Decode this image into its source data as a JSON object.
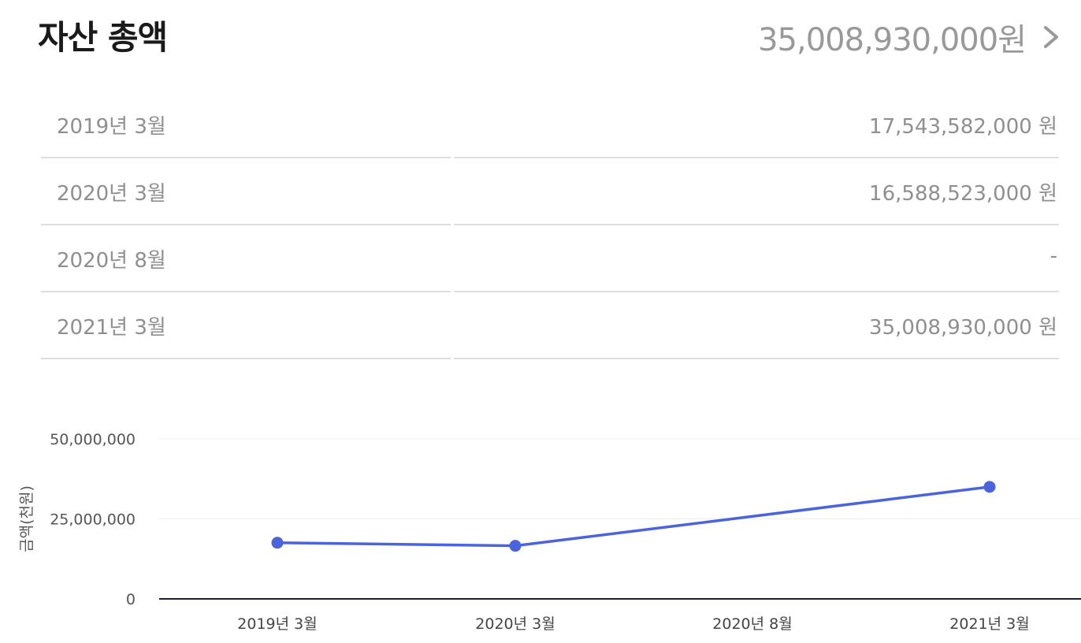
{
  "header": {
    "title": "자산 총액",
    "total": "35,008,930,000원"
  },
  "icons": {
    "total_link": "chevron-right-icon"
  },
  "table": {
    "rows": [
      {
        "label": "2019년 3월",
        "value": "17,543,582,000 원"
      },
      {
        "label": "2020년 3월",
        "value": "16,588,523,000 원"
      },
      {
        "label": "2020년 8월",
        "value": "-"
      },
      {
        "label": "2021년 3월",
        "value": "35,008,930,000 원"
      }
    ]
  },
  "chart_data": {
    "type": "line",
    "categories": [
      "2019년 3월",
      "2020년 3월",
      "2020년 8월",
      "2021년 3월"
    ],
    "series": [
      {
        "values": [
          17543582,
          16588523,
          null,
          35008930
        ]
      }
    ],
    "ylabel": "금액(천원)",
    "ylim": [
      0,
      50000000
    ],
    "yticks": [
      0,
      25000000,
      50000000
    ],
    "ytick_labels": [
      "0",
      "25,000,000",
      "50,000,000"
    ],
    "grid": true,
    "line_color": "#4b63dd"
  }
}
